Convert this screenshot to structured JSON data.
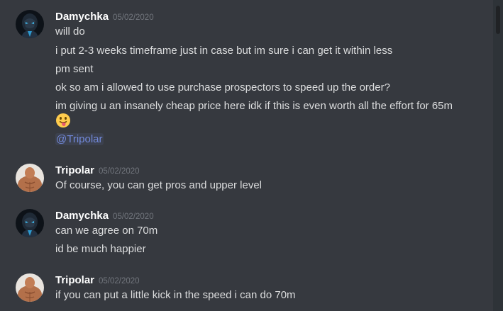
{
  "messages": [
    {
      "author": "Damychka",
      "timestamp": "05/02/2020",
      "avatar_icon": "dark-hooded-figure-icon",
      "lines": [
        "will do",
        "i put 2-3 weeks timeframe just in case but im sure i can get it within less",
        "pm sent",
        "ok so am i allowed to use purchase prospectors to speed up the order?",
        "im giving u an insanely cheap price here idk if this is even worth all the effort for 65m"
      ],
      "emoji": "tongue-out-emoji",
      "mention": "@Tripolar"
    },
    {
      "author": "Tripolar",
      "timestamp": "05/02/2020",
      "avatar_icon": "muscular-person-icon",
      "lines": [
        "Of course, you can get pros and upper level"
      ]
    },
    {
      "author": "Damychka",
      "timestamp": "05/02/2020",
      "avatar_icon": "dark-hooded-figure-icon",
      "lines": [
        "can we agree on 70m",
        "id be much happier"
      ]
    },
    {
      "author": "Tripolar",
      "timestamp": "05/02/2020",
      "avatar_icon": "muscular-person-icon",
      "lines": [
        "if you can put a little kick in the speed i can do 70m"
      ]
    }
  ],
  "colors": {
    "background": "#36393f",
    "username": "#ffffff",
    "timestamp": "#72767d",
    "text": "#dcddde",
    "mention": "#7289da"
  }
}
